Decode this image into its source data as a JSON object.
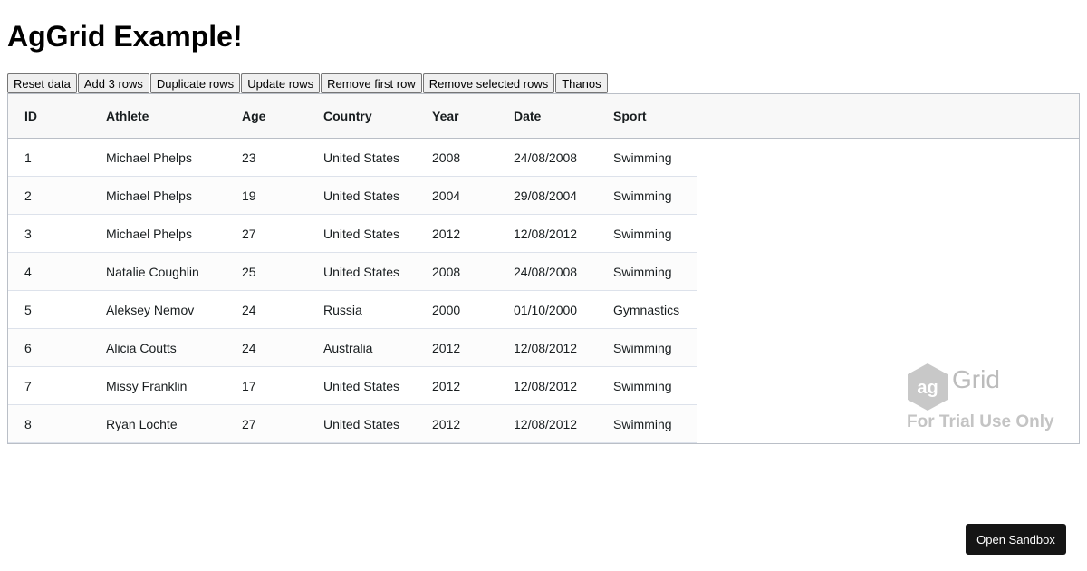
{
  "page": {
    "title": "AgGrid Example!"
  },
  "toolbar": {
    "buttons": [
      "Reset data",
      "Add 3 rows",
      "Duplicate rows",
      "Update rows",
      "Remove first row",
      "Remove selected rows",
      "Thanos"
    ]
  },
  "grid": {
    "columns": [
      "ID",
      "Athlete",
      "Age",
      "Country",
      "Year",
      "Date",
      "Sport"
    ],
    "rows": [
      {
        "id": "1",
        "athlete": "Michael Phelps",
        "age": "23",
        "country": "United States",
        "year": "2008",
        "date": "24/08/2008",
        "sport": "Swimming"
      },
      {
        "id": "2",
        "athlete": "Michael Phelps",
        "age": "19",
        "country": "United States",
        "year": "2004",
        "date": "29/08/2004",
        "sport": "Swimming"
      },
      {
        "id": "3",
        "athlete": "Michael Phelps",
        "age": "27",
        "country": "United States",
        "year": "2012",
        "date": "12/08/2012",
        "sport": "Swimming"
      },
      {
        "id": "4",
        "athlete": "Natalie Coughlin",
        "age": "25",
        "country": "United States",
        "year": "2008",
        "date": "24/08/2008",
        "sport": "Swimming"
      },
      {
        "id": "5",
        "athlete": "Aleksey Nemov",
        "age": "24",
        "country": "Russia",
        "year": "2000",
        "date": "01/10/2000",
        "sport": "Gymnastics"
      },
      {
        "id": "6",
        "athlete": "Alicia Coutts",
        "age": "24",
        "country": "Australia",
        "year": "2012",
        "date": "12/08/2012",
        "sport": "Swimming"
      },
      {
        "id": "7",
        "athlete": "Missy Franklin",
        "age": "17",
        "country": "United States",
        "year": "2012",
        "date": "12/08/2012",
        "sport": "Swimming"
      },
      {
        "id": "8",
        "athlete": "Ryan Lochte",
        "age": "27",
        "country": "United States",
        "year": "2012",
        "date": "12/08/2012",
        "sport": "Swimming"
      }
    ]
  },
  "watermark": {
    "brand": "Grid",
    "logo_letters": "ag",
    "notice": "For Trial Use Only"
  },
  "sandbox": {
    "label": "Open Sandbox"
  },
  "colors": {
    "header_bg": "#f8f8f8",
    "border": "#babfc7",
    "row_border": "#dde2eb",
    "sandbox_bg": "#151515"
  }
}
